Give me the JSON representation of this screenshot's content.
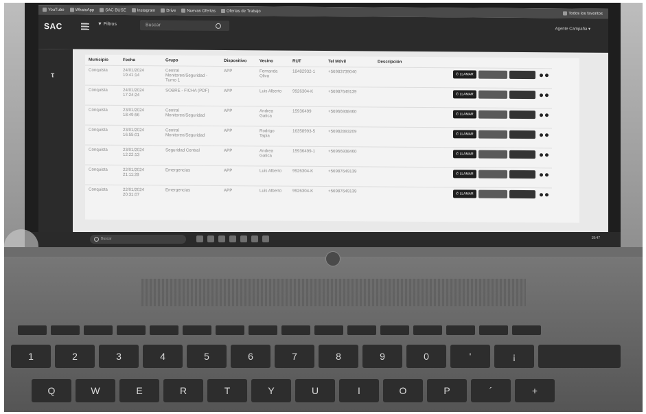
{
  "browser": {
    "bookmarks": [
      "YouTube",
      "WhatsApp",
      "SAC BUSE",
      "Instagram",
      "Drive",
      "Nuevas Ofertas",
      "Ofertas de Trabajo",
      "Todos los favoritos"
    ]
  },
  "app": {
    "brand": "SAC",
    "filters_label": "Filtros",
    "search_placeholder": "Buscar",
    "user_label": "Agente Campaña"
  },
  "table": {
    "headers": [
      "Municipio",
      "Fecha",
      "Grupo",
      "Dispositivo",
      "Vecino",
      "RUT",
      "Tel Móvil",
      "Descripción"
    ],
    "call_label": "LLAMAR",
    "rows": [
      {
        "municipio": "Conquista",
        "fecha": "24/01/2024 19:41:14",
        "grupo": "Central Monitoreo/Seguridad - Turno 1",
        "dispositivo": "APP",
        "vecino": "Fernanda Oliva",
        "rut": "18482932-1",
        "tel": "+56983739040",
        "descripcion": ""
      },
      {
        "municipio": "Conquista",
        "fecha": "24/01/2024 17:24:24",
        "grupo": "SOBRE - FICHA (PDF)",
        "dispositivo": "APP",
        "vecino": "Luis Alberto",
        "rut": "9926304-K",
        "tel": "+56987649139",
        "descripcion": ""
      },
      {
        "municipio": "Conquista",
        "fecha": "23/01/2024 18:49:56",
        "grupo": "Central Monitoreo/Seguridad",
        "dispositivo": "APP",
        "vecino": "Andrea Gatica",
        "rut": "15936499",
        "tel": "+56966938460",
        "descripcion": ""
      },
      {
        "municipio": "Conquista",
        "fecha": "23/01/2024 16:55:01",
        "grupo": "Central Monitoreo/Seguridad",
        "dispositivo": "APP",
        "vecino": "Rodrigo Tapia",
        "rut": "16358993-5",
        "tel": "+56982893209",
        "descripcion": ""
      },
      {
        "municipio": "Conquista",
        "fecha": "23/01/2024 12:22:13",
        "grupo": "Seguridad Central",
        "dispositivo": "APP",
        "vecino": "Andrea Gatica",
        "rut": "15936499-1",
        "tel": "+56966938460",
        "descripcion": ""
      },
      {
        "municipio": "Conquista",
        "fecha": "22/01/2024 21:11:28",
        "grupo": "Emergencias",
        "dispositivo": "APP",
        "vecino": "Luis Alberto",
        "rut": "9926304-K",
        "tel": "+56987649139",
        "descripcion": ""
      },
      {
        "municipio": "Conquista",
        "fecha": "22/01/2024 20:31:07",
        "grupo": "Emergencias",
        "dispositivo": "APP",
        "vecino": "Luis Alberto",
        "rut": "9926304-K",
        "tel": "+56987649139",
        "descripcion": ""
      }
    ]
  },
  "taskbar": {
    "search_placeholder": "Buscar",
    "clock": "19:47"
  },
  "keyboard": {
    "number_row": [
      "!",
      "\"",
      "#",
      "$",
      "%",
      "&",
      "/",
      "(",
      ")",
      "=",
      "?",
      "¿"
    ],
    "number_sub": [
      "1",
      "2",
      "3",
      "4",
      "5",
      "6",
      "7",
      "8",
      "9",
      "0",
      "'",
      "¡"
    ],
    "letter_row": [
      "Q",
      "W",
      "E",
      "R",
      "T",
      "Y",
      "U",
      "I",
      "O",
      "P",
      "´",
      "+"
    ]
  }
}
